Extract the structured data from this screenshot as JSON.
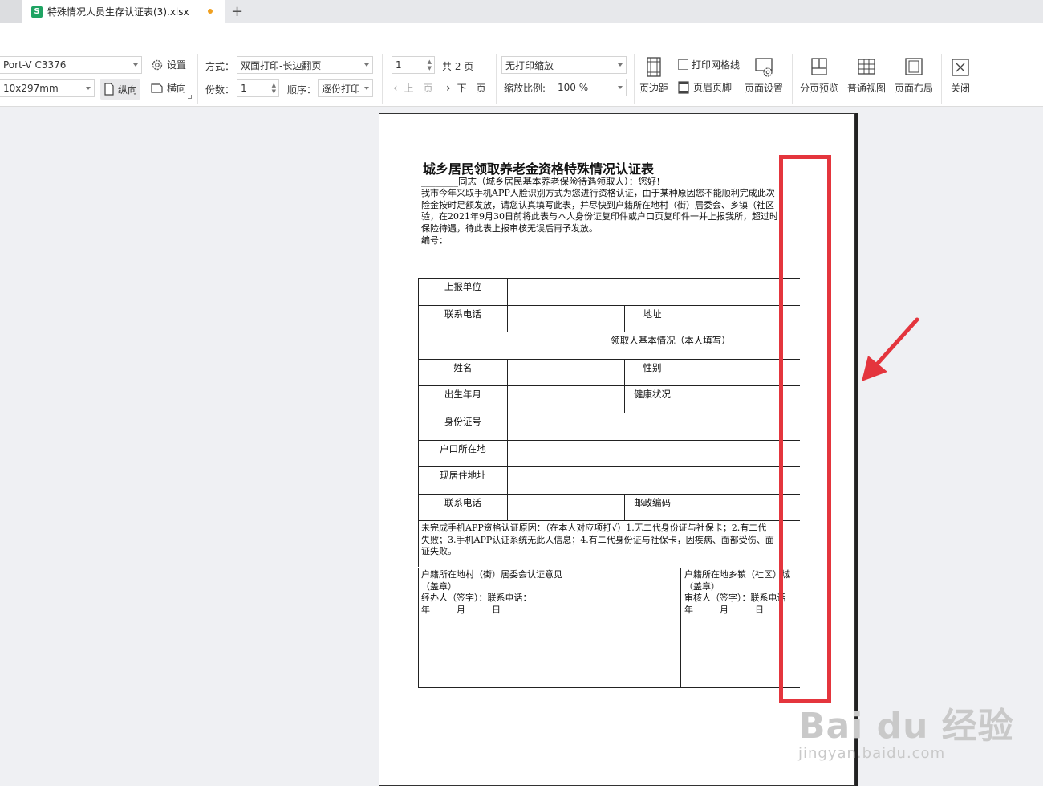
{
  "tab": {
    "title": "特殊情况人员生存认证表(3).xlsx",
    "icon": "S"
  },
  "toolbar": {
    "printer": "Port-V C3376",
    "paper_size": "10x297mm",
    "settings": "设置",
    "portrait": "纵向",
    "landscape": "横向",
    "mode_label": "方式：",
    "mode_value": "双面打印-长边翻页",
    "copies_label": "份数：",
    "copies_value": "1",
    "order_label": "顺序：",
    "order_value": "逐份打印",
    "page_value": "1",
    "total_pages": "共 2 页",
    "prev_page": "上一页",
    "next_page": "下一页",
    "scale_mode": "无打印缩放",
    "zoom_label": "缩放比例:",
    "zoom_value": "100 %",
    "print_gridlines": "打印网格线",
    "header_footer": "页眉页脚",
    "margins": "页边距",
    "page_setup": "页面设置",
    "page_break_preview": "分页预览",
    "normal_view": "普通视图",
    "page_layout": "页面布局",
    "close": "关闭"
  },
  "doc": {
    "title": "城乡居民领取养老金资格特殊情况认证表",
    "greeting": "________同志（城乡居民基本养老保险待遇领取人）：您好!",
    "para1": "我市今年采取手机APP人脸识别方式为您进行资格认证，由于某种原因您不能顺利完成此次",
    "para2": "险金按时足额发放，请您认真填写此表，并尽快到户籍所在地村（街）居委会、乡镇（社区",
    "para3": "验，在2021年9月30日前将此表与本人身份证复印件或户口页复印件一并上报我所，超过时",
    "para4": "保险待遇，待此表上报审核无误后再予发放。",
    "serial": "编号：",
    "unit": "上报单位",
    "phone1": "联系电话",
    "address": "地址",
    "section": "领取人基本情况（本人填写）",
    "name": "姓名",
    "gender": "性别",
    "birth": "出生年月",
    "health": "健康状况",
    "id": "身份证号",
    "hukou": "户口所在地",
    "residence": "现居住地址",
    "phone2": "联系电话",
    "postcode": "邮政编码",
    "reason1": "未完成手机APP资格认证原因：（在本人对应项打√）1.无二代身份证与社保卡；2.有二代",
    "reason2": "失败；3.手机APP认证系统无此人信息；4.有二代身份证与社保卡，因疾病、面部受伤、面",
    "reason3": "证失败。",
    "village_opinion": "户籍所在地村（街）居委会认证意见",
    "stamp": "（盖章）",
    "handler": "经办人（签字）：联系电话：",
    "date": "年　　　月　　　日",
    "town_opinion": "户籍所在地乡镇（社区）城",
    "stamp2": "（盖章）",
    "reviewer": "审核人（签字）：联系电话",
    "date2": "年　　　月　　　日"
  },
  "watermark": {
    "brand": "Bai du 经验",
    "url": "jingyan.baidu.com"
  },
  "colors": {
    "highlight": "#e4353d",
    "tab_icon": "#1fa463",
    "unsaved_dot": "#f0a020"
  }
}
